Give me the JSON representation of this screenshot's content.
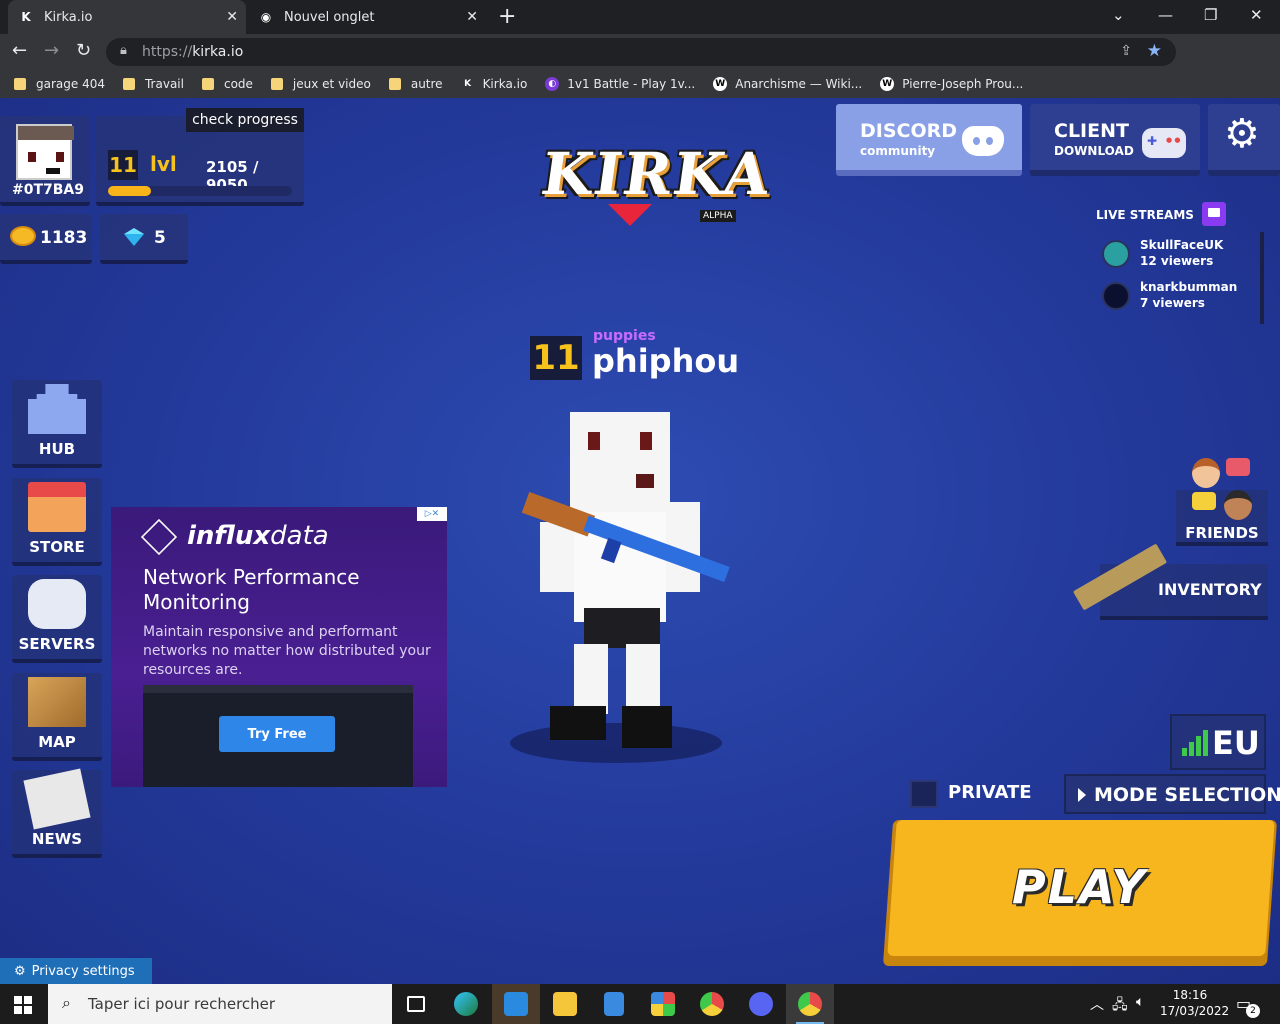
{
  "browser": {
    "tabs": [
      {
        "title": "Kirka.io",
        "active": true
      },
      {
        "title": "Nouvel onglet",
        "active": false
      }
    ],
    "url_scheme": "https://",
    "url_host": "kirka.io",
    "bookmarks": [
      {
        "label": "garage 404",
        "type": "folder"
      },
      {
        "label": "Travail",
        "type": "folder"
      },
      {
        "label": "code",
        "type": "folder"
      },
      {
        "label": "jeux et video",
        "type": "folder"
      },
      {
        "label": "autre",
        "type": "folder"
      },
      {
        "label": "Kirka.io",
        "type": "site"
      },
      {
        "label": "1v1 Battle - Play 1v...",
        "type": "site"
      },
      {
        "label": "Anarchisme — Wiki...",
        "type": "site"
      },
      {
        "label": "Pierre-Joseph Prou...",
        "type": "site"
      }
    ]
  },
  "game": {
    "player": {
      "id": "#0T7BA9",
      "level": "11",
      "level_word": "lvl",
      "xp_text": "2105 / 9050",
      "xp_fraction": 0.2326,
      "coins": "1183",
      "gems": "5",
      "check_progress": "check progress",
      "clan": "puppies",
      "name": "phiphou"
    },
    "logo": {
      "text": "KIRKA",
      "tag": "ALPHA"
    },
    "discord": {
      "title": "DISCORD",
      "subtitle": "community"
    },
    "client": {
      "title": "CLIENT",
      "subtitle": "DOWNLOAD"
    },
    "live_streams": {
      "title": "LIVE STREAMS",
      "items": [
        {
          "name": "SkullFaceUK",
          "viewers": "12 viewers"
        },
        {
          "name": "knarkbumman",
          "viewers": "7 viewers"
        }
      ]
    },
    "left_menu": [
      {
        "label": "HUB",
        "icon": "castle-icon"
      },
      {
        "label": "STORE",
        "icon": "shop-icon"
      },
      {
        "label": "SERVERS",
        "icon": "gamepad-icon"
      },
      {
        "label": "MAP",
        "icon": "box-icon"
      },
      {
        "label": "NEWS",
        "icon": "newspaper-icon"
      }
    ],
    "right_menu": {
      "friends": "FRIENDS",
      "inventory": "INVENTORY",
      "region": "EU",
      "private": "PRIVATE",
      "mode_selection": "MODE SELECTION",
      "play": "PLAY"
    },
    "privacy": "Privacy settings",
    "ad": {
      "brand_bold": "influx",
      "brand_rest": "data",
      "title": "Network Performance Monitoring",
      "description": "Maintain responsive and performant networks no matter how distributed your resources are.",
      "cta": "Try Free"
    }
  },
  "taskbar": {
    "search_placeholder": "Taper ici pour rechercher",
    "time": "18:16",
    "date": "17/03/2022",
    "notifications": "2"
  },
  "colors": {
    "accent_gold": "#f7b51e",
    "discord": "#8aa0e6",
    "game_bg": "#23399a",
    "clan": "#c96bff"
  }
}
